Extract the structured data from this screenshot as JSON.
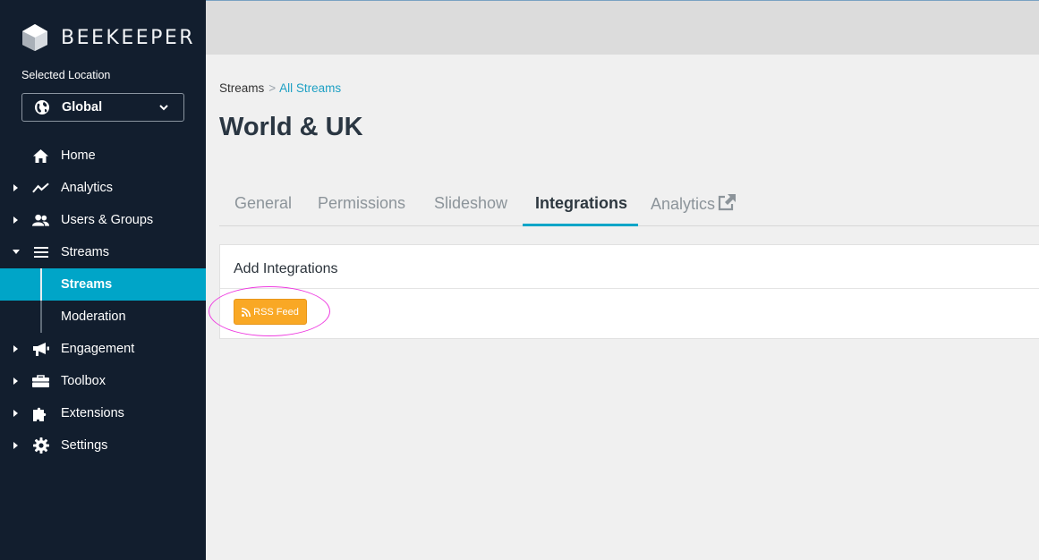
{
  "app": {
    "logo_text": "BEEKEEPER"
  },
  "sidebar": {
    "location_label": "Selected Location",
    "location_value": "Global",
    "items": [
      {
        "label": "Home",
        "icon": "home-icon"
      },
      {
        "label": "Analytics",
        "icon": "chart-line-icon"
      },
      {
        "label": "Users & Groups",
        "icon": "users-icon"
      },
      {
        "label": "Streams",
        "icon": "bars-icon"
      },
      {
        "label": "Engagement",
        "icon": "megaphone-icon"
      },
      {
        "label": "Toolbox",
        "icon": "toolbox-icon"
      },
      {
        "label": "Extensions",
        "icon": "puzzle-icon"
      },
      {
        "label": "Settings",
        "icon": "gear-icon"
      }
    ],
    "sub_items": [
      {
        "label": "Streams",
        "active": true
      },
      {
        "label": "Moderation",
        "active": false
      }
    ]
  },
  "breadcrumb": {
    "root": "Streams",
    "separator": ">",
    "current": "All Streams"
  },
  "page": {
    "title": "World & UK"
  },
  "tabs": [
    {
      "label": "General"
    },
    {
      "label": "Permissions"
    },
    {
      "label": "Slideshow"
    },
    {
      "label": "Integrations",
      "active": true
    },
    {
      "label": "Analytics",
      "icon": "external-link-icon"
    }
  ],
  "panel": {
    "title": "Add Integrations",
    "button_label": "RSS Feed"
  },
  "colors": {
    "sidebar_bg": "#121e2e",
    "accent": "#00a5c8",
    "button": "#f9a825",
    "highlight": "#ee3ce0"
  }
}
